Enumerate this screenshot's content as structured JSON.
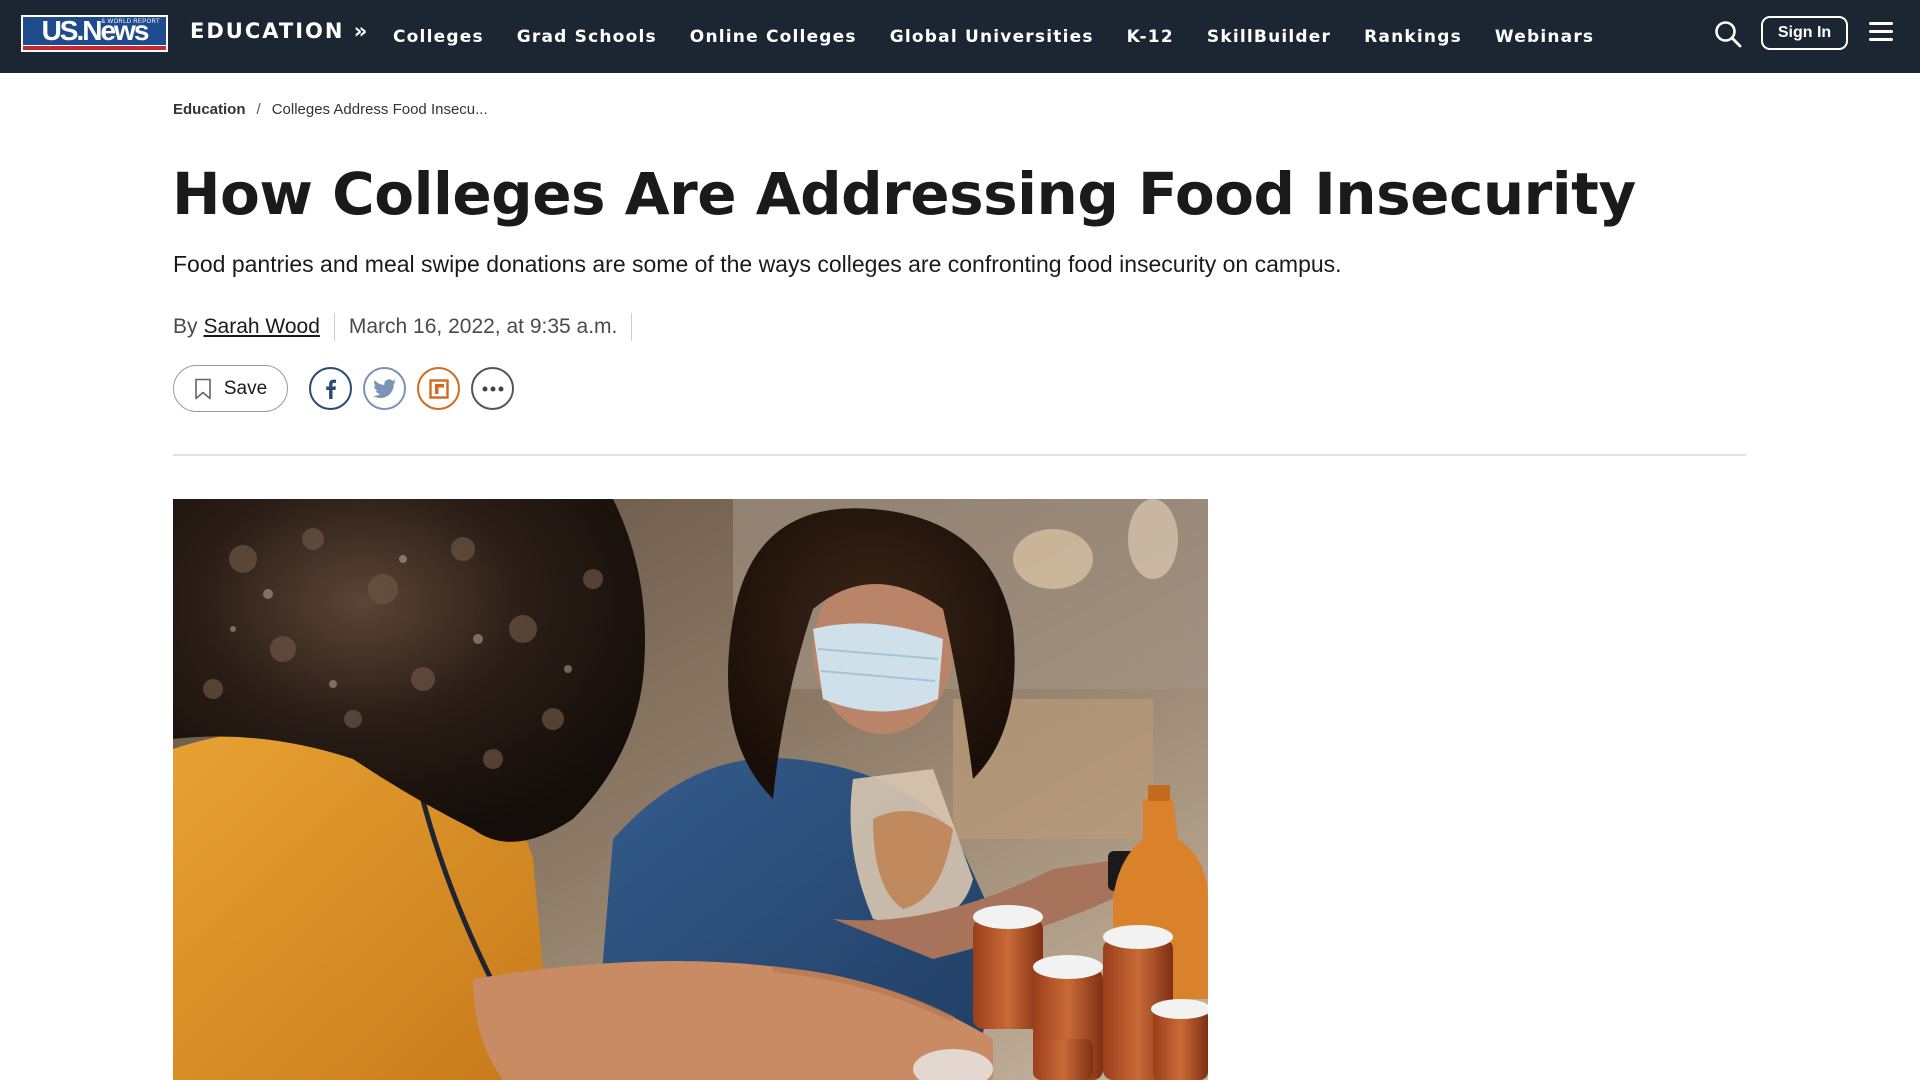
{
  "header": {
    "logo": {
      "wordmark": "US.News",
      "subtitle": "& WORLD REPORT"
    },
    "section_title": "EDUCATION »",
    "nav_items": [
      "Colleges",
      "Grad Schools",
      "Online Colleges",
      "Global Universities",
      "K-12",
      "SkillBuilder",
      "Rankings",
      "Webinars"
    ],
    "sign_in_label": "Sign In",
    "search_icon": "search-icon",
    "menu_icon": "hamburger-menu-icon"
  },
  "breadcrumb": {
    "home": "Education",
    "separator": "/",
    "current": "Colleges Address Food Insecu..."
  },
  "article": {
    "headline": "How Colleges Are Addressing Food Insecurity",
    "dek": "Food pantries and meal swipe donations are some of the ways colleges are confronting food insecurity on campus.",
    "byline_prefix": "By",
    "author": "Sarah Wood",
    "date": "March 16, 2022, at 9:35 a.m."
  },
  "share": {
    "save_label": "Save",
    "icons": [
      "facebook-icon",
      "twitter-icon",
      "flipboard-icon",
      "more-options-icon"
    ]
  },
  "colors": {
    "nav_bg": "#1c2633",
    "logo_blue": "#1f4a8b",
    "logo_red": "#c8282d",
    "facebook": "#2c4a74",
    "twitter": "#7c93b8",
    "flipboard": "#d36a1e"
  }
}
